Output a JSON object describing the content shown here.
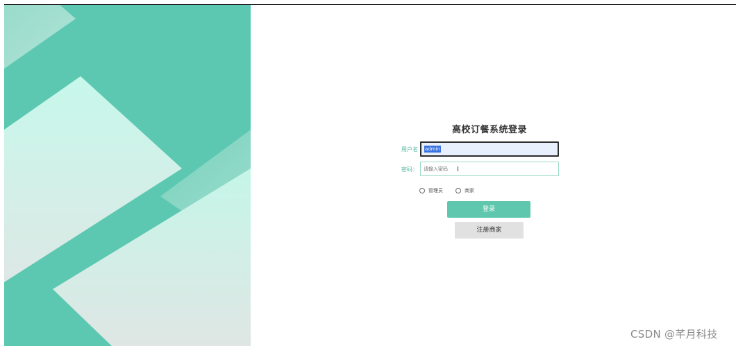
{
  "login": {
    "title": "高校订餐系统登录",
    "username_label": "用户名",
    "username_value": "admin",
    "password_label": "密码：",
    "password_placeholder": "请输入密码",
    "roles": [
      {
        "label": "管理员",
        "selected": false
      },
      {
        "label": "商家",
        "selected": false
      }
    ],
    "login_label": "登录",
    "register_label": "注册商家"
  },
  "watermark": "CSDN @芊月科技",
  "colors": {
    "accent": "#5ec7ad",
    "hero_background": "#5dc8b1",
    "hero_light": "#c6f7ea",
    "input_border": "#9adbc6",
    "register_button": "#e1e1e1"
  },
  "icons": {
    "radio": "radio-circle",
    "cursor": "text-cursor-icon"
  }
}
